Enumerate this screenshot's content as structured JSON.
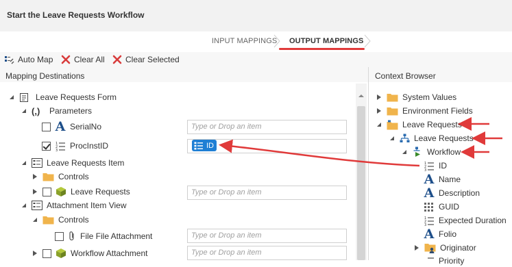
{
  "header": {
    "title": "Start the Leave Requests Workflow"
  },
  "tabs": [
    {
      "label": "INPUT MAPPINGS",
      "active": false
    },
    {
      "label": "OUTPUT MAPPINGS",
      "active": true
    }
  ],
  "toolbar": {
    "auto_map": "Auto Map",
    "clear_all": "Clear All",
    "clear_selected": "Clear Selected"
  },
  "mapping": {
    "title": "Mapping Destinations",
    "items": {
      "leave_requests_form": "Leave Requests Form",
      "parameters": "Parameters",
      "serial_no": "SerialNo",
      "proc_inst_id": "ProcInstID",
      "leave_requests_item": "Leave Requests Item",
      "controls": "Controls",
      "leave_requests": "Leave Requests",
      "attachment_item_view": "Attachment Item View",
      "controls2": "Controls",
      "file_attachment": "File File Attachment",
      "workflow_attachment": "Workflow Attachment"
    },
    "placeholder": "Type or Drop an item",
    "mapped_chip": "ID",
    "parameters_glyph": "(,)"
  },
  "context": {
    "title": "Context Browser",
    "items": {
      "system_values": "System Values",
      "environment_fields": "Environment Fields",
      "leave_requests": "Leave Requests",
      "leave_requests_child": "Leave Requests",
      "workflow": "Workflow",
      "id": "ID",
      "name": "Name",
      "description": "Description",
      "guid": "GUID",
      "expected_duration": "Expected Duration",
      "folio": "Folio",
      "originator": "Originator",
      "priority": "Priority"
    }
  },
  "colors": {
    "accent": "#e03a3a",
    "chip": "#1f7fd4",
    "folder": "#f0b44c",
    "icon_blue": "#1e4f8a"
  }
}
